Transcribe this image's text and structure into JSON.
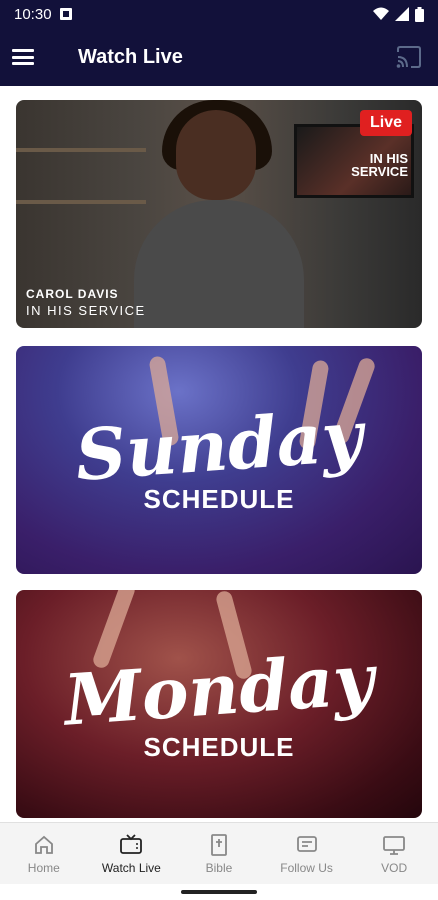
{
  "status_bar": {
    "time": "10:30"
  },
  "app_bar": {
    "title": "Watch Live"
  },
  "cards": [
    {
      "badge": "Live",
      "speaker_name": "CAROL DAVIS",
      "series": "IN HIS SERVICE",
      "tv_text_line1": "IN HIS",
      "tv_text_line2": "SERVICE"
    },
    {
      "script_title": "Sunday",
      "subtitle": "SCHEDULE"
    },
    {
      "script_title": "Monday",
      "subtitle": "SCHEDULE"
    }
  ],
  "bottom_nav": {
    "items": [
      {
        "label": "Home",
        "icon": "home-icon"
      },
      {
        "label": "Watch Live",
        "icon": "tv-icon"
      },
      {
        "label": "Bible",
        "icon": "bible-icon"
      },
      {
        "label": "Follow Us",
        "icon": "message-icon"
      },
      {
        "label": "VOD",
        "icon": "monitor-icon"
      }
    ],
    "active": "Watch Live"
  }
}
